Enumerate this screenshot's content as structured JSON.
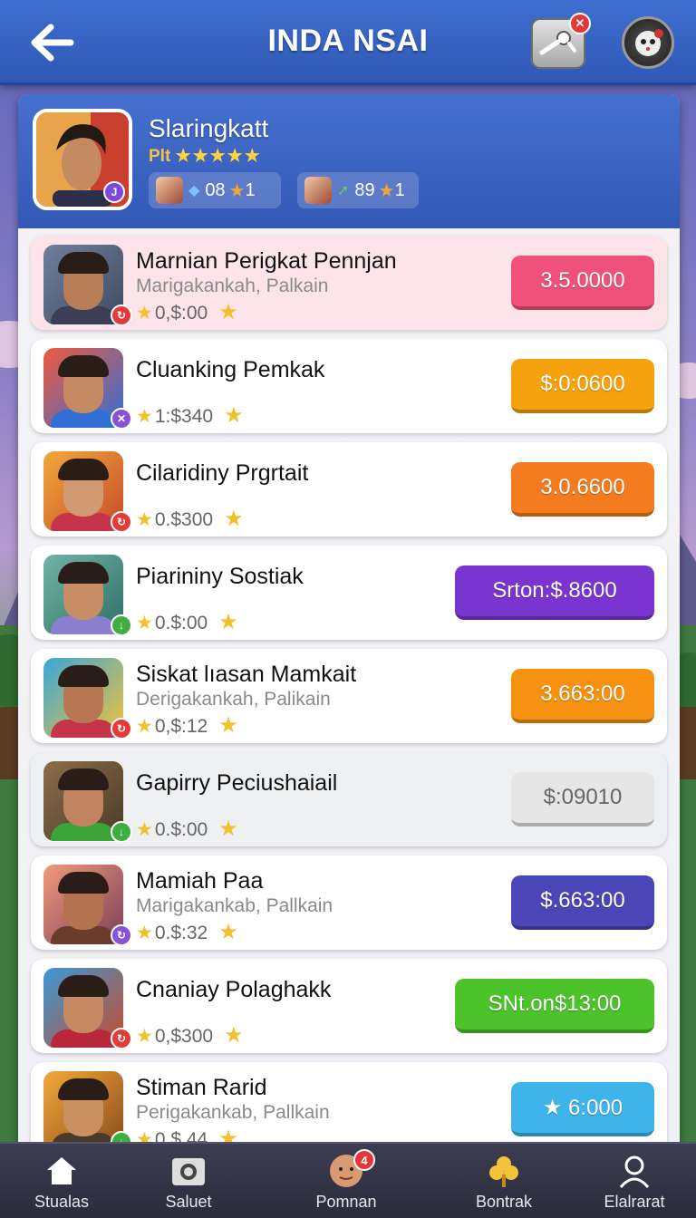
{
  "header": {
    "title": "INDA NSAI",
    "tool_badge": "✕"
  },
  "profile": {
    "name": "Slaringkatt",
    "rating_label": "Plt",
    "rating_stars": "★★★★★",
    "stat1_value": "08",
    "stat1_count": "1",
    "stat2_value": "89",
    "stat2_count": "1",
    "level_badge": "J"
  },
  "list": [
    {
      "name": "Marnian Perigkat Pennjan",
      "sub": "Marigakankah, Palkain",
      "score": "0,$:00",
      "price": "3.5.0000",
      "price_color": "#f0517a",
      "badge_color": "#e33a3a",
      "badge_icon": "↻",
      "highlight": true
    },
    {
      "name": "Cluanking Pemkak",
      "sub": "",
      "score": "1:$340",
      "price": "$:0:0600",
      "price_color": "#f6a20f",
      "badge_color": "#8b4fd8",
      "badge_icon": "✕"
    },
    {
      "name": "Cilaridiny Prgrtait",
      "sub": "",
      "score": "0.$300",
      "price": "3.0.6600",
      "price_color": "#f47c1e",
      "badge_color": "#e33a3a",
      "badge_icon": "↻"
    },
    {
      "name": "Piarininy Sostiak",
      "sub": "",
      "score": "0.$:00",
      "price": "Srton:$.8600",
      "price_color": "#7a35d0",
      "badge_color": "#3fae3f",
      "badge_icon": "↓"
    },
    {
      "name": "Siskat lıasan Mamkait",
      "sub": "Derigakankah, Palikain",
      "score": "0,$:12",
      "price": "3.663:00",
      "price_color": "#f6920f",
      "badge_color": "#e33a3a",
      "badge_icon": "↻"
    },
    {
      "name": "Gapirry  Peciushaiail",
      "sub": "",
      "score": "0.$:00",
      "price": "$:09010",
      "price_color": "#e6e6e6",
      "price_text_color": "#666666",
      "badge_color": "#3fae3f",
      "badge_icon": "↓",
      "muted": true
    },
    {
      "name": "Mamiah Paa",
      "sub": "Marigakankab, Pallkain",
      "score": "0.$:32",
      "price": "$.663:00",
      "price_color": "#4b46b8",
      "badge_color": "#8b4fd8",
      "badge_icon": "↻"
    },
    {
      "name": "Cnaniay Polaghakk",
      "sub": "",
      "score": "0,$300",
      "price": "SNt.on$13:00",
      "price_color": "#4cc22b",
      "badge_color": "#e33a3a",
      "badge_icon": "↻"
    },
    {
      "name": "Stiman Rarid",
      "sub": "Perigakankab, Pallkain",
      "score": "0.$.44",
      "price": "★ 6:000",
      "price_color": "#3fb4ea",
      "badge_color": "#3fae3f",
      "badge_icon": "↓"
    }
  ],
  "nav": {
    "items": [
      {
        "label": "Stualas",
        "icon": "home-icon"
      },
      {
        "label": "Saluet",
        "icon": "camera-icon"
      },
      {
        "label": "Pomnan",
        "icon": "avatar-icon",
        "badge": "4"
      },
      {
        "label": "Bontrak",
        "icon": "clover-icon"
      },
      {
        "label": "Elalrarat",
        "icon": "user-icon"
      }
    ]
  }
}
